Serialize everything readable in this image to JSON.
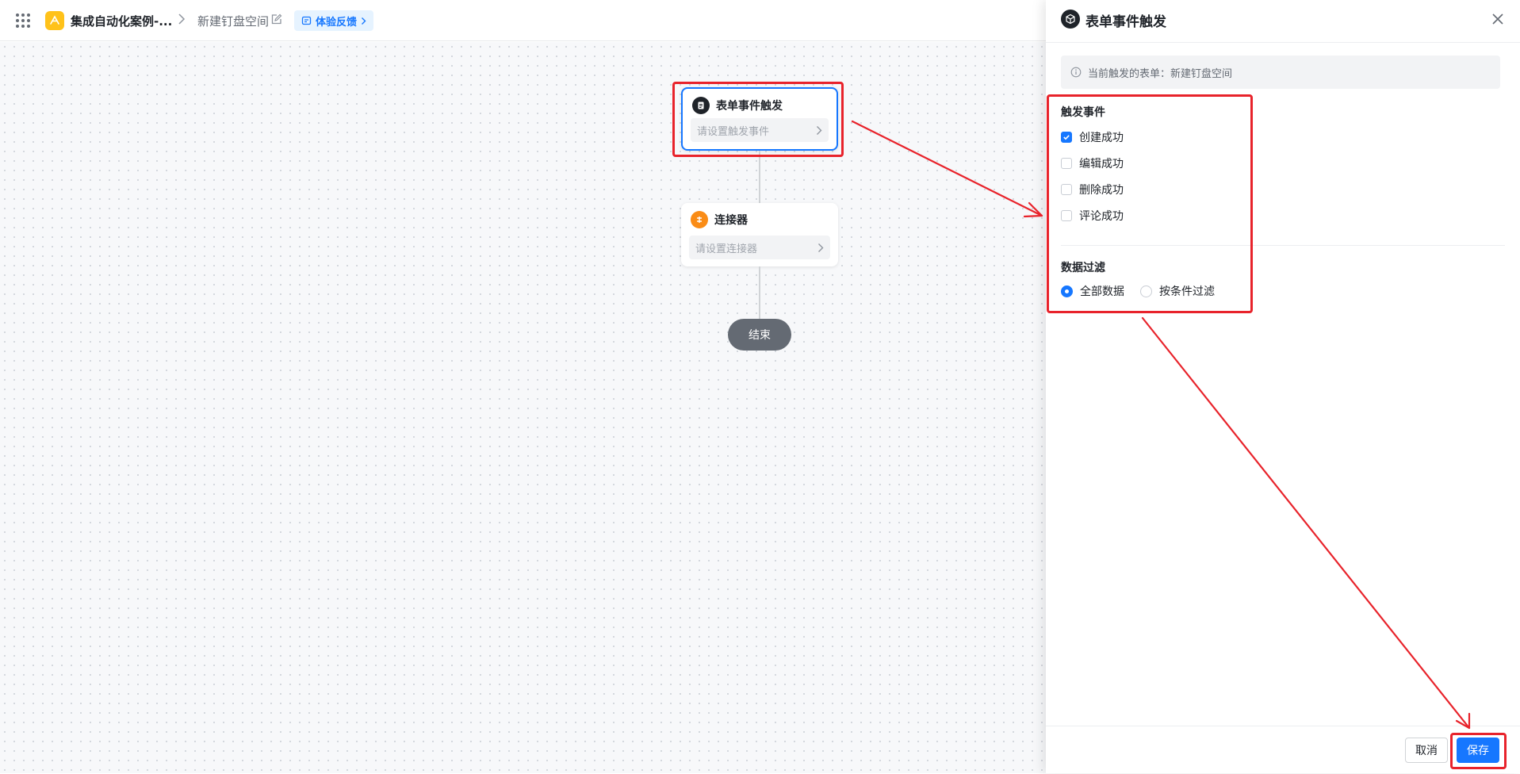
{
  "header": {
    "app_name": "集成自动化案例-...",
    "page_name": "新建钉盘空间",
    "feedback_label": "体验反馈"
  },
  "canvas": {
    "trigger_node": {
      "title": "表单事件触发",
      "placeholder": "请设置触发事件"
    },
    "connector_node": {
      "title": "连接器",
      "placeholder": "请设置连接器"
    },
    "end_node": {
      "label": "结束"
    }
  },
  "drawer": {
    "title": "表单事件触发",
    "info": "当前触发的表单：新建钉盘空间",
    "trigger_section_title": "触发事件",
    "trigger_options": [
      {
        "label": "创建成功",
        "checked": true
      },
      {
        "label": "编辑成功",
        "checked": false
      },
      {
        "label": "删除成功",
        "checked": false
      },
      {
        "label": "评论成功",
        "checked": false
      }
    ],
    "filter_section_title": "数据过滤",
    "filter_options": [
      {
        "label": "全部数据",
        "selected": true
      },
      {
        "label": "按条件过滤",
        "selected": false
      }
    ],
    "cancel_label": "取消",
    "save_label": "保存"
  },
  "colors": {
    "accent": "#1677ff",
    "annotation": "#e8232b",
    "app_logo": "#ffc21a",
    "connector_icon": "#fa8c16"
  }
}
